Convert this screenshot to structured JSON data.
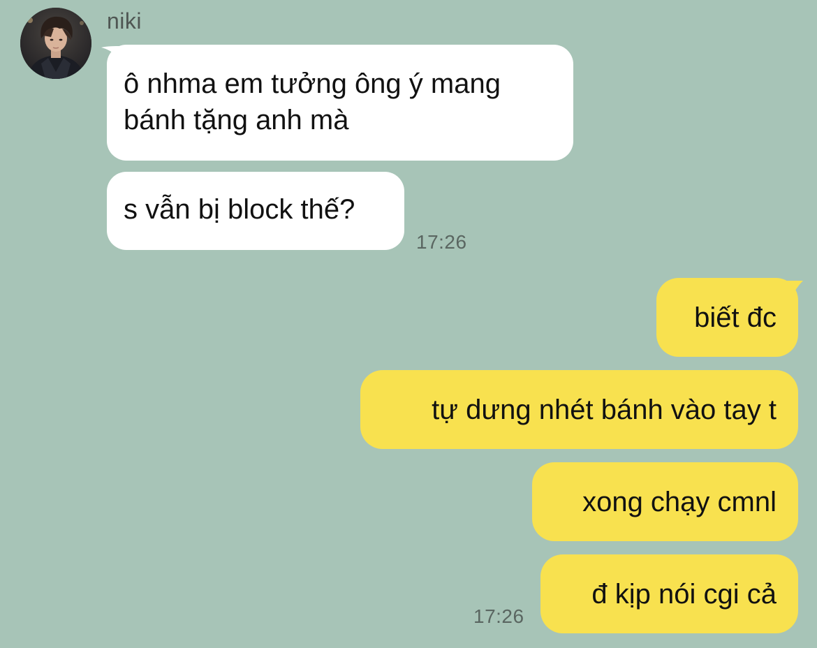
{
  "contact": {
    "name": "niki",
    "avatar_icon": "profile-photo"
  },
  "colors": {
    "background": "#a7c4b7",
    "incoming_bubble": "#ffffff",
    "outgoing_bubble": "#f8e14f"
  },
  "messages_in": [
    {
      "lines": [
        "ô nhma em tưởng ông ý mang",
        "bánh tặng anh mà"
      ]
    },
    {
      "lines": [
        "s vẫn bị block thế?"
      ]
    }
  ],
  "time_in": "17:26",
  "messages_out": [
    {
      "text": "biết đc"
    },
    {
      "text": "tự dưng nhét bánh vào tay t"
    },
    {
      "text": "xong chạy cmnl"
    },
    {
      "text": "đ kịp nói cgi cả"
    }
  ],
  "time_out": "17:26"
}
